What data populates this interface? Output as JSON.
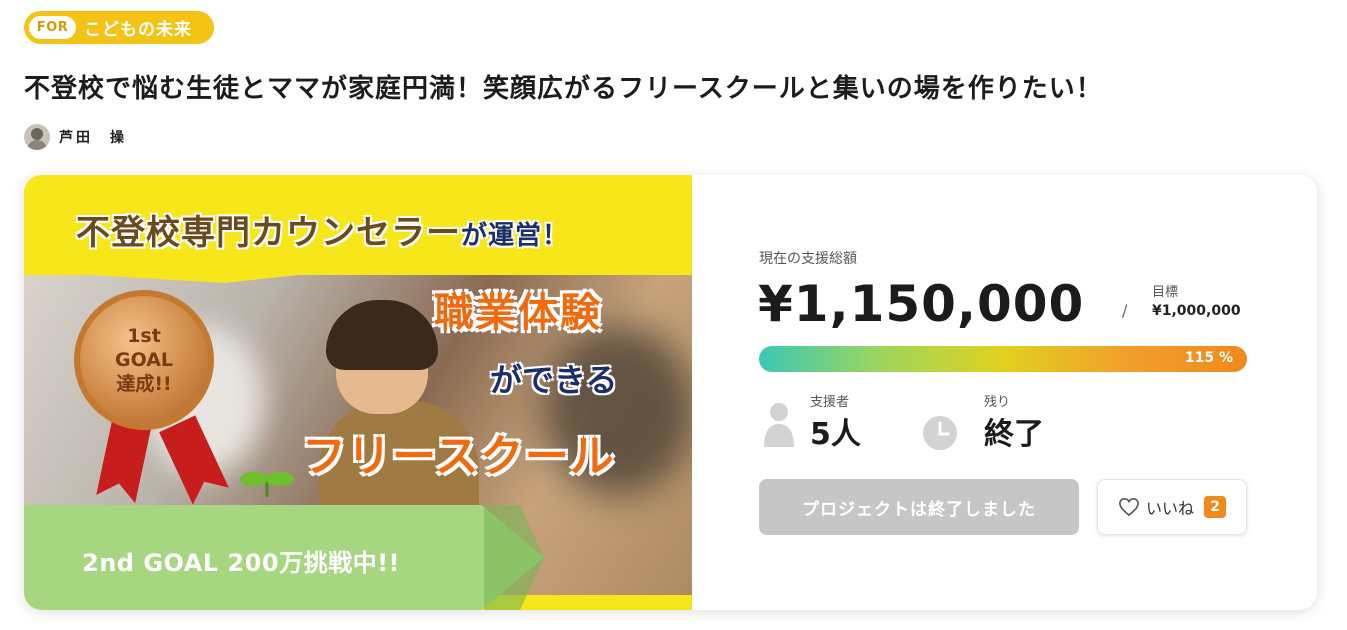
{
  "category": {
    "for_label": "FOR",
    "name": "こどもの未来"
  },
  "project": {
    "title": "不登校で悩む生徒とママが家庭円満！笑顔広がるフリースクールと集いの場を作りたい！",
    "author": "芦田　操"
  },
  "visual": {
    "headline_main": "不登校専門カウンセラー",
    "headline_sub": "が運営！",
    "keyword1": "職業体験",
    "keyword2": "ができる",
    "keyword3": "フリースクール",
    "medal_lines": [
      "1st",
      "GOAL",
      "達成!!"
    ],
    "goal_banner": "2nd  GOAL 200万挑戦中!!"
  },
  "stats": {
    "total_label": "現在の支援総額",
    "total_amount": "¥1,150,000",
    "separator": "/",
    "goal_label": "目標",
    "goal_amount": "¥1,000,000",
    "progress_label": "115 %",
    "progress_ratio": 1.15,
    "supporters_label": "支援者",
    "supporters_value": "5人",
    "remaining_label": "残り",
    "remaining_value": "終了"
  },
  "actions": {
    "ended_button": "プロジェクトは終了しました",
    "like_label": "いいね",
    "like_count": "2"
  },
  "colors": {
    "accent": "#f3c315",
    "like_badge": "#f08a1d",
    "progress_start": "#3cc8b4",
    "progress_end": "#f08a1d",
    "disabled_button": "#c6c6c6"
  },
  "icons": [
    "user-icon",
    "clock-icon",
    "heart-icon"
  ]
}
